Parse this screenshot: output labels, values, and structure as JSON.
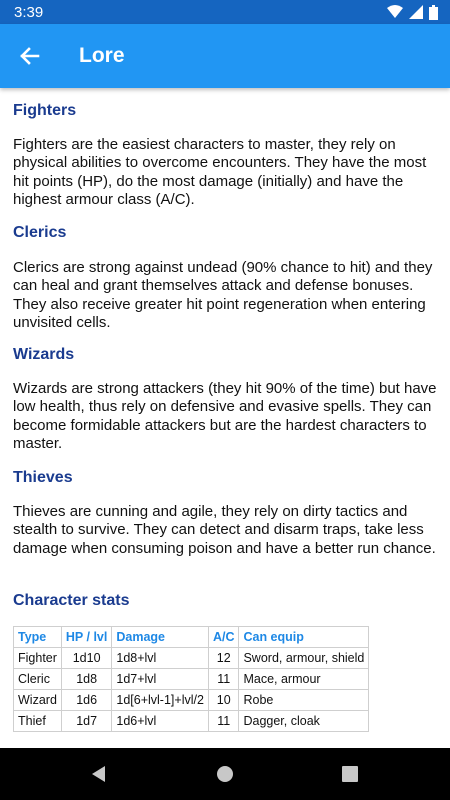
{
  "status_bar": {
    "time": "3:39"
  },
  "app_bar": {
    "title": "Lore"
  },
  "sections": [
    {
      "title": "Fighters",
      "text": "Fighters are the easiest characters to master, they rely on physical abilities to overcome encounters. They have the most hit points (HP), do the most damage (initially) and have the highest armour class (A/C)."
    },
    {
      "title": "Clerics",
      "text": "Clerics are strong against undead (90% chance to hit) and they can heal and grant themselves attack and defense bonuses. They also receive greater hit point regeneration when entering unvisited cells."
    },
    {
      "title": "Wizards",
      "text": "Wizards are strong attackers (they hit 90% of the time) but have low health, thus rely on defensive and evasive spells. They can become formidable attackers but are the hardest characters to master."
    },
    {
      "title": "Thieves",
      "text": "Thieves are cunning and agile, they rely on dirty tactics and stealth to survive. They can detect and disarm traps, take less damage when consuming poison and have a better run chance."
    }
  ],
  "stats": {
    "title": "Character stats",
    "headers": [
      "Type",
      "HP / lvl",
      "Damage",
      "A/C",
      "Can equip"
    ],
    "rows": [
      [
        "Fighter",
        "1d10",
        "1d8+lvl",
        "12",
        "Sword, armour, shield"
      ],
      [
        "Cleric",
        "1d8",
        "1d7+lvl",
        "11",
        "Mace, armour"
      ],
      [
        "Wizard",
        "1d6",
        "1d[6+lvl-1]+lvl/2",
        "10",
        "Robe"
      ],
      [
        "Thief",
        "1d7",
        "1d6+lvl",
        "11",
        "Dagger, cloak"
      ]
    ]
  },
  "colors": {
    "status_bar": "#1565c0",
    "app_bar": "#2196f3",
    "section_title": "#1a3b8f",
    "table_header": "#1e88e5"
  },
  "icons": {
    "back": "arrow-back-icon",
    "wifi": "wifi-icon",
    "signal": "signal-icon",
    "battery": "battery-icon",
    "nav_back": "nav-back-icon",
    "nav_home": "nav-home-icon",
    "nav_recents": "nav-recents-icon"
  }
}
